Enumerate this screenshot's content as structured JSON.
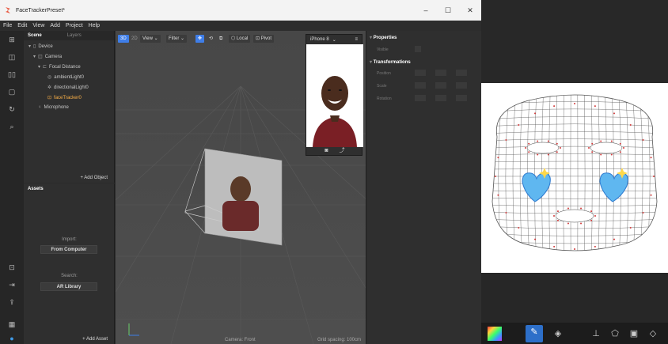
{
  "window": {
    "title": "FaceTrackerPreset*",
    "minimize": "–",
    "maximize": "☐",
    "close": "✕"
  },
  "menu": [
    "File",
    "Edit",
    "View",
    "Add",
    "Project",
    "Help"
  ],
  "scene": {
    "tabs": [
      "Scene",
      "Layers"
    ],
    "tree": [
      {
        "label": "Device",
        "icon": "▯"
      },
      {
        "label": "Camera",
        "icon": "◫"
      },
      {
        "label": "Focal Distance",
        "icon": "⊏"
      },
      {
        "label": "ambientLight0",
        "icon": "◎"
      },
      {
        "label": "directionalLight0",
        "icon": "✲"
      },
      {
        "label": "faceTracker0",
        "icon": "⊡"
      },
      {
        "label": "Microphone",
        "icon": "♀"
      }
    ],
    "add_object": "+ Add Object"
  },
  "assets": {
    "title": "Assets",
    "import_label": "Import:",
    "from_computer": "From Computer",
    "search_label": "Search:",
    "ar_library": "AR Library",
    "add_asset": "+ Add Asset"
  },
  "viewport": {
    "mode_3d": "3D",
    "mode_2d": "2D",
    "view": "View",
    "filter": "Filter",
    "local": "Local",
    "pivot": "Pivot",
    "camera_label": "Camera: Front",
    "grid_label": "Grid spacing: 100cm"
  },
  "device": {
    "name": "iPhone 8"
  },
  "properties": {
    "header": "Properties",
    "visible": "Visible",
    "transformations": "Transformations",
    "position": "Position",
    "scale": "Scale",
    "rotation": "Rotation"
  },
  "colors": {
    "accent": "#3f7ee8",
    "selected": "#ffb347",
    "mesh": "#d23b3b"
  }
}
